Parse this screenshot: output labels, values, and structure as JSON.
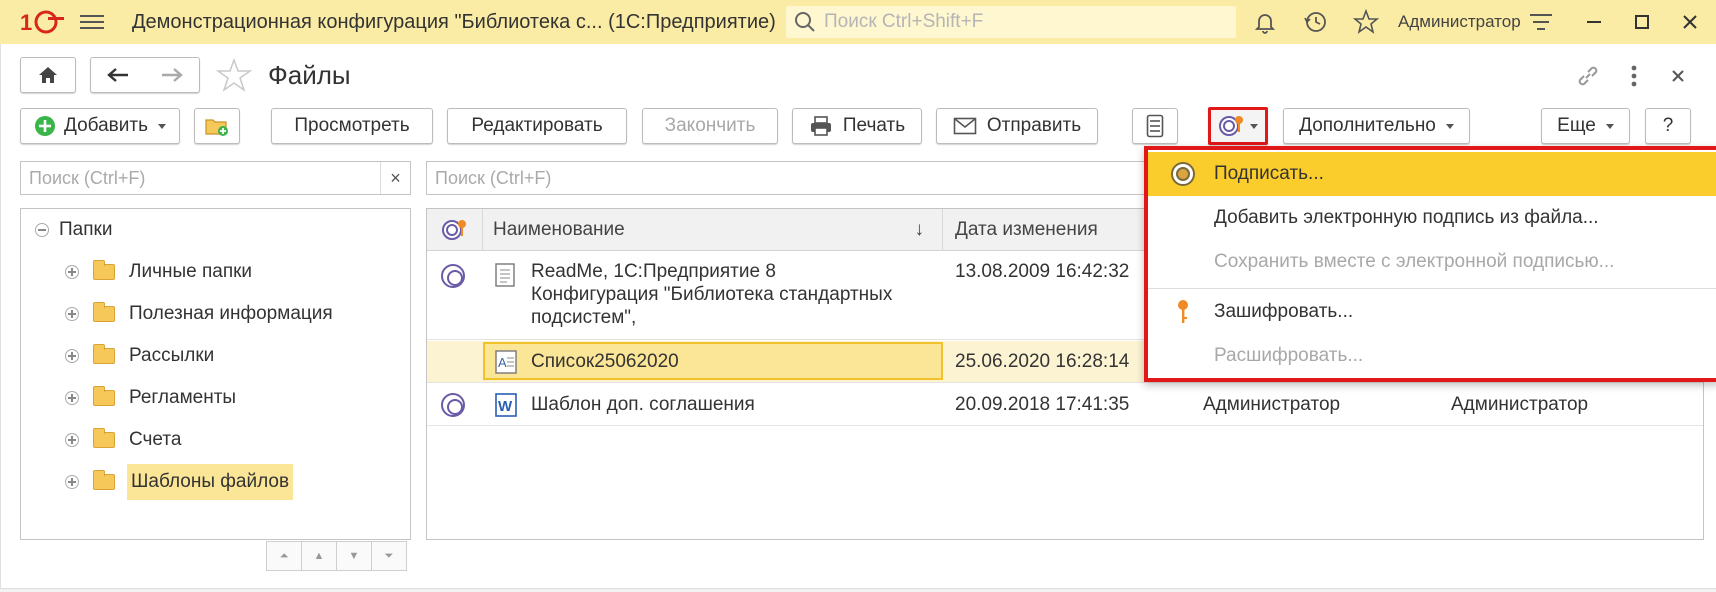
{
  "titlebar": {
    "app_title": "Демонстрационная конфигурация \"Библиотека с...  (1С:Предприятие)",
    "search_placeholder": "Поиск Ctrl+Shift+F",
    "user": "Администратор"
  },
  "nav": {
    "page_title": "Файлы"
  },
  "toolbar": {
    "add": "Добавить",
    "view": "Просмотреть",
    "edit": "Редактировать",
    "finish": "Закончить",
    "print": "Печать",
    "send": "Отправить",
    "more_actions": "Дополнительно",
    "more": "Еще",
    "help": "?"
  },
  "tree_search": {
    "placeholder": "Поиск (Ctrl+F)",
    "clear": "×"
  },
  "list_search": {
    "placeholder": "Поиск (Ctrl+F)"
  },
  "tree": {
    "root": "Папки",
    "items": [
      {
        "label": "Личные папки"
      },
      {
        "label": "Полезная информация"
      },
      {
        "label": "Рассылки"
      },
      {
        "label": "Регламенты"
      },
      {
        "label": "Счета"
      },
      {
        "label": "Шаблоны файлов"
      }
    ]
  },
  "table": {
    "columns": {
      "name": "Наименование",
      "sort_arrow": "↓",
      "modified": "Дата изменения"
    },
    "rows": [
      {
        "name_lines": [
          "ReadMe, 1С:Предприятие 8",
          "Конфигурация \"Библиотека стандартных",
          "подсистем\","
        ],
        "modified": "13.08.2009 16:42:32"
      },
      {
        "name": "Список25062020",
        "modified": "25.06.2020 16:28:14"
      },
      {
        "name": "Шаблон доп. соглашения",
        "modified": "20.09.2018 17:41:35",
        "author": "Администратор",
        "editor": "Администратор"
      }
    ]
  },
  "signature_menu": {
    "items": [
      {
        "label": "Подписать...",
        "state": "highlighted"
      },
      {
        "label": "Добавить электронную подпись из файла...",
        "state": "enabled"
      },
      {
        "label": "Сохранить вместе с электронной подписью...",
        "state": "disabled"
      },
      {
        "label": "Зашифровать...",
        "state": "enabled"
      },
      {
        "label": "Расшифровать...",
        "state": "disabled"
      }
    ]
  },
  "colors": {
    "titlebar": "#fbeca5",
    "highlight": "#fbcd2c",
    "selection": "#fbe596",
    "menu_border": "#e01818",
    "add_icon": "#3ab54a"
  },
  "icons": {
    "logo": "1c-logo",
    "menu": "hamburger-icon",
    "bell": "bell-icon",
    "history": "history-icon",
    "star": "star-icon",
    "settings": "sliders-icon",
    "signature": "signature-icon",
    "key": "key-icon",
    "link": "link-icon"
  }
}
